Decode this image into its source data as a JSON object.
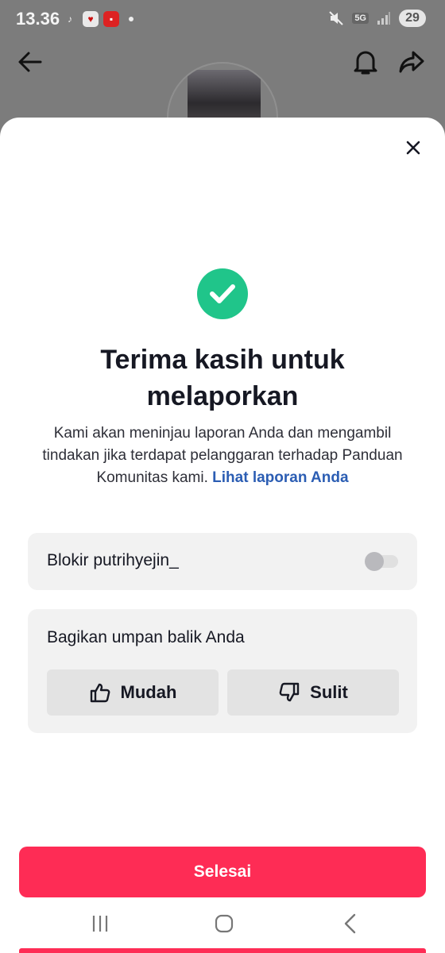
{
  "status_bar": {
    "time": "13.36",
    "network": "5G",
    "battery": "29"
  },
  "sheet": {
    "title": "Terima kasih untuk melaporkan",
    "description": "Kami akan meninjau laporan Anda dan mengambil tindakan jika terdapat pelanggaran terhadap Panduan Komunitas kami.",
    "description_link": "Lihat laporan Anda",
    "block": {
      "label": "Blokir putrihyejin_",
      "enabled": false
    },
    "feedback": {
      "label": "Bagikan umpan balik Anda",
      "easy_label": "Mudah",
      "hard_label": "Sulit"
    },
    "done_label": "Selesai"
  },
  "colors": {
    "accent": "#fe2c55",
    "success": "#20c58a",
    "link": "#2b5db3"
  },
  "icons": [
    "back-arrow-icon",
    "bell-icon",
    "share-icon",
    "close-icon",
    "checkmark-icon",
    "thumbs-up-icon",
    "thumbs-down-icon",
    "recent-apps-icon",
    "home-icon",
    "back-icon"
  ]
}
